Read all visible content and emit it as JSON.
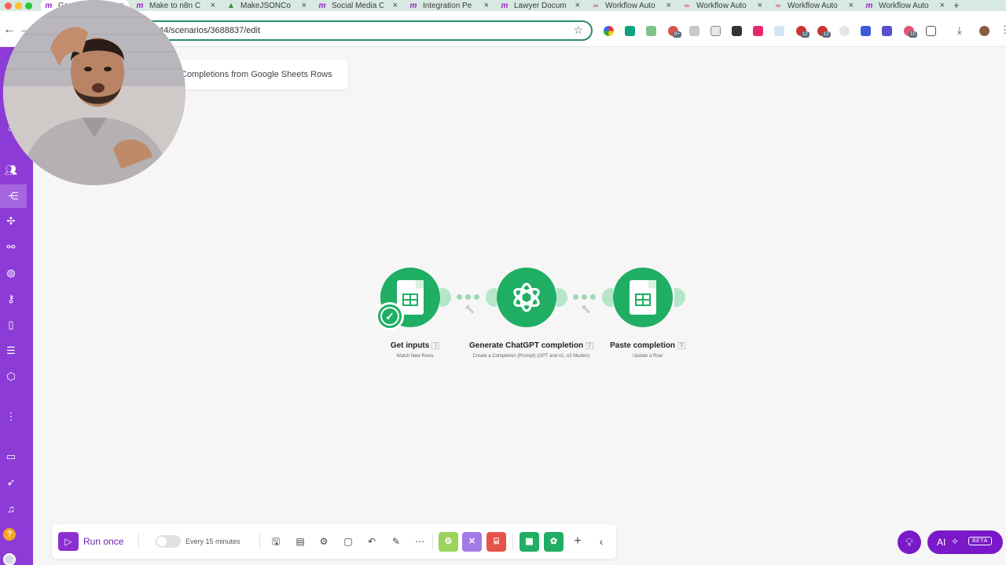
{
  "browser": {
    "tabs": [
      {
        "label": "Gene",
        "favicon": "make-icon",
        "active": true
      },
      {
        "label": "Make to n8n C",
        "favicon": "make-icon"
      },
      {
        "label": "MakeJSONCo",
        "favicon": "drive-icon"
      },
      {
        "label": "Social Media C",
        "favicon": "make-icon"
      },
      {
        "label": "Integration Pe",
        "favicon": "make-icon"
      },
      {
        "label": "Lawyer Docum",
        "favicon": "make-icon"
      },
      {
        "label": "Workflow Auto",
        "favicon": "n8n-icon"
      },
      {
        "label": "Workflow Auto",
        "favicon": "n8n-icon"
      },
      {
        "label": "Workflow Auto",
        "favicon": "n8n-icon"
      },
      {
        "label": "Workflow Auto",
        "favicon": "make-icon"
      }
    ],
    "address": "44/scenarios/3688837/edit",
    "extension_badges": [
      "9+",
      "12",
      "12",
      "10"
    ]
  },
  "scenario": {
    "title": "Completions from Google Sheets Rows"
  },
  "modules": [
    {
      "name": "Get inputs",
      "number": "1",
      "subtitle": "Watch New Rows",
      "icon": "google-sheets-icon"
    },
    {
      "name": "Generate ChatGPT completion",
      "number": "2",
      "subtitle": "Create a Completion (Prompt) (GPT and o1, o3 Models)",
      "icon": "openai-icon"
    },
    {
      "name": "Paste completion",
      "number": "3",
      "subtitle": "Update a Row",
      "icon": "google-sheets-icon"
    }
  ],
  "bottom_bar": {
    "run_label": "Run once",
    "schedule_label": "Every 15 minutes",
    "tool_tiles": [
      {
        "icon": "gear-icon",
        "color": "#9bd45b"
      },
      {
        "icon": "tools-icon",
        "color": "#a47ae4"
      },
      {
        "icon": "flow-control-icon",
        "color": "#e5534b"
      },
      {
        "icon": "google-sheets-icon",
        "color": "#1fae63"
      },
      {
        "icon": "openai-icon",
        "color": "#1fae63"
      }
    ]
  },
  "ai_assistant": {
    "label": "AI",
    "badge": "BETA"
  },
  "colors": {
    "sidebar": "#8d3bd6",
    "module_green": "#1fae63",
    "brand_purple": "#7a19c9"
  }
}
